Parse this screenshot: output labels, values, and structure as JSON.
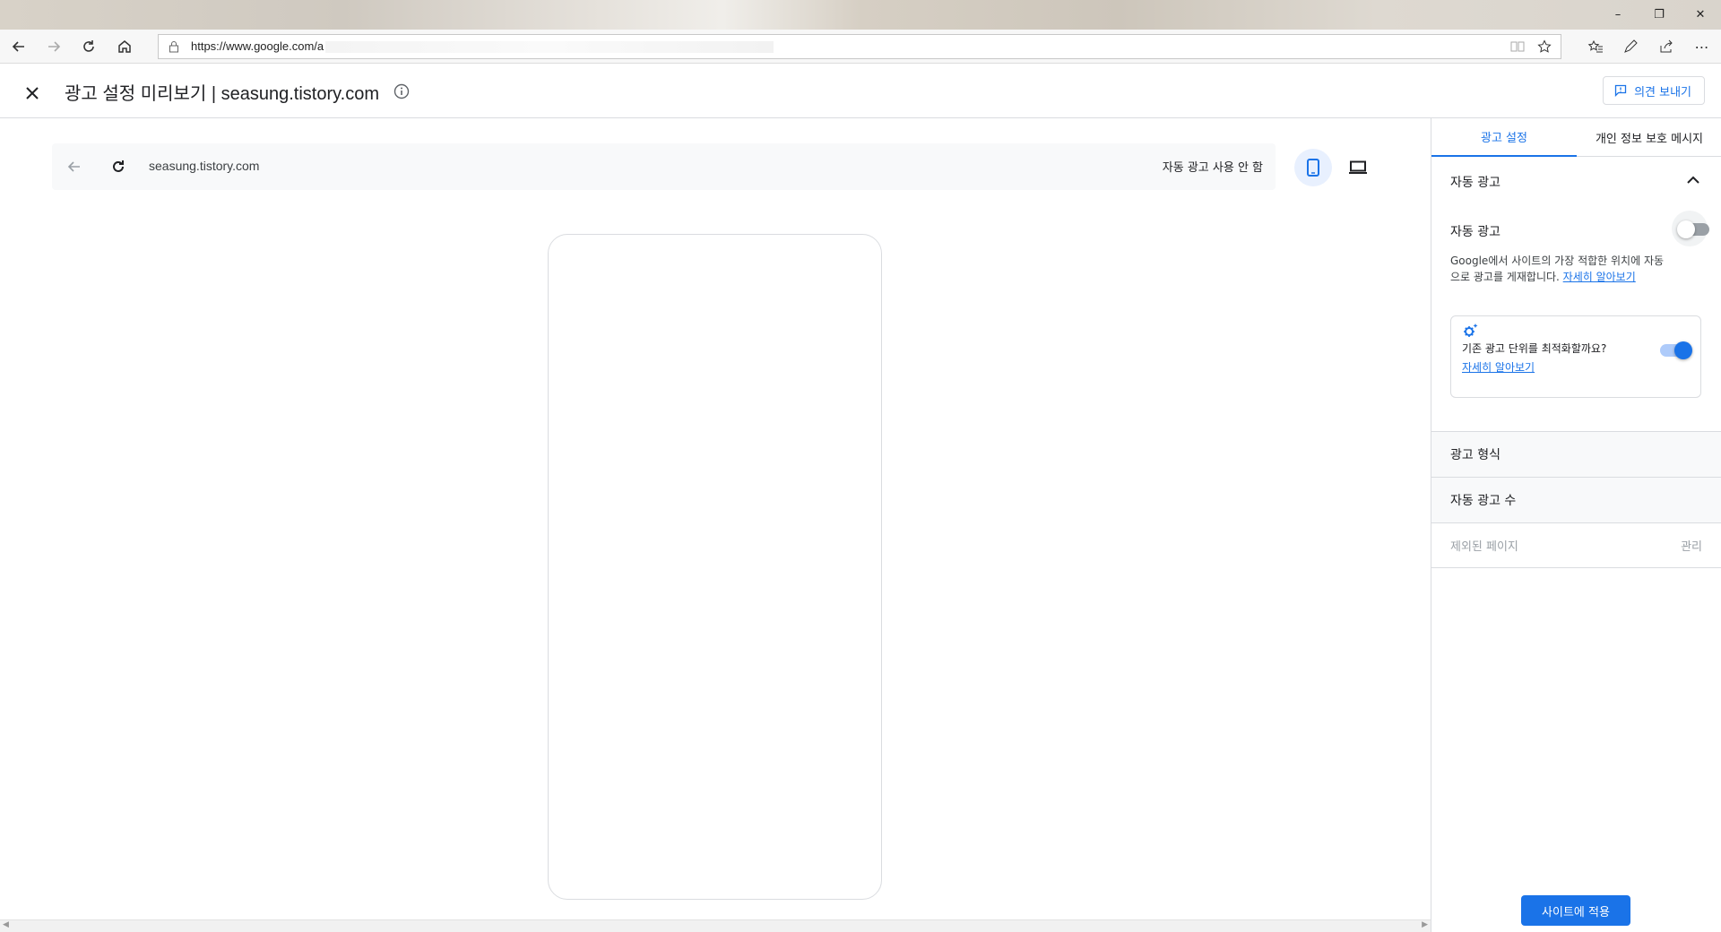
{
  "browser": {
    "url": "https://www.google.com/a",
    "window_controls": {
      "minimize": "–",
      "restore": "❐",
      "close": "✕"
    }
  },
  "header": {
    "title": "광고 설정 미리보기 | seasung.tistory.com",
    "feedback_label": "의견 보내기"
  },
  "preview_bar": {
    "url": "seasung.tistory.com",
    "status": "자동 광고 사용 안 함"
  },
  "sidebar": {
    "tabs": [
      "광고 설정",
      "개인 정보 보호 메시지"
    ],
    "auto_ads_section_title": "자동 광고",
    "auto_ads_toggle_label": "자동 광고",
    "auto_ads_enabled": false,
    "auto_ads_description": "Google에서 사이트의 가장 적합한 위치에 자동으로 광고를 게재합니다. ",
    "auto_ads_learn_more": "자세히 알아보기",
    "optimize_card": {
      "question": "기존 광고 단위를 최적화할까요?",
      "learn_more": "자세히 알아보기",
      "enabled": true
    },
    "rows": {
      "ad_formats": "광고 형식",
      "ad_load": "자동 광고 수",
      "excluded_pages": "제외된 페이지",
      "manage": "관리"
    },
    "apply_button": "사이트에 적용"
  },
  "colors": {
    "accent": "#1a73e8",
    "border": "#dadce0",
    "muted": "#9aa0a6"
  }
}
